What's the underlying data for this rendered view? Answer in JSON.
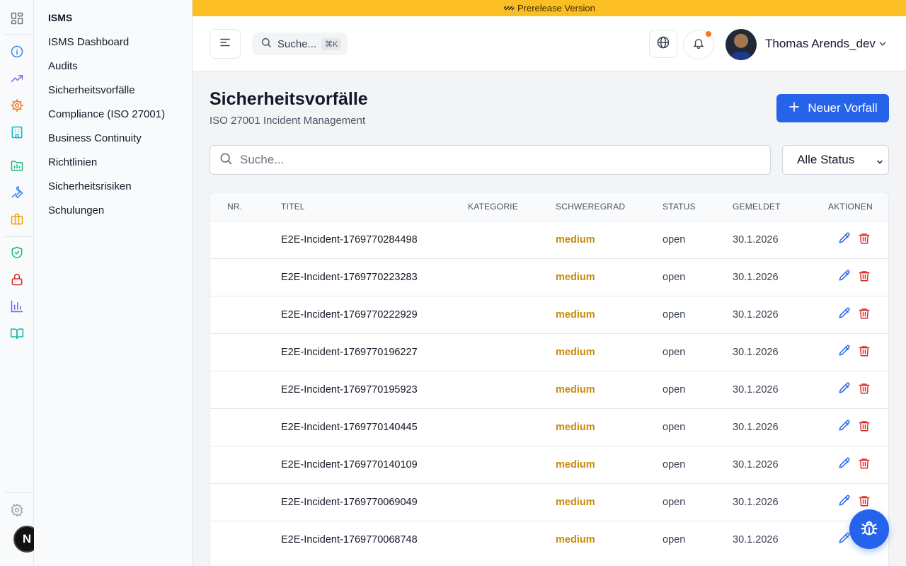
{
  "banner": {
    "text": "🚧 Prerelease Version"
  },
  "subnav": {
    "title": "ISMS",
    "items": [
      {
        "label": "ISMS Dashboard"
      },
      {
        "label": "Audits"
      },
      {
        "label": "Sicherheitsvorfälle"
      },
      {
        "label": "Compliance (ISO 27001)"
      },
      {
        "label": "Business Continuity"
      },
      {
        "label": "Richtlinien"
      },
      {
        "label": "Sicherheitsrisiken"
      },
      {
        "label": "Schulungen"
      }
    ]
  },
  "rail": {
    "icons": [
      "grid-icon",
      "info-icon",
      "trending-up-icon",
      "cog-icon",
      "building-icon",
      "folder-chart-icon",
      "wrench-icon",
      "briefcase-icon",
      "shield-check-icon",
      "lock-icon",
      "bar-chart-icon",
      "book-open-icon",
      "settings-icon"
    ],
    "badge": "N"
  },
  "header": {
    "search_placeholder": "Suche...",
    "search_shortcut": "⌘K",
    "user_name": "Thomas Arends_dev"
  },
  "page": {
    "title": "Sicherheitsvorfälle",
    "subtitle": "ISO 27001 Incident Management",
    "new_button_label": "Neuer Vorfall",
    "search_placeholder": "Suche...",
    "status_filter": "Alle Status"
  },
  "table": {
    "columns": [
      "NR.",
      "TITEL",
      "KATEGORIE",
      "SCHWEREGRAD",
      "STATUS",
      "GEMELDET",
      "AKTIONEN"
    ],
    "rows": [
      {
        "nr": "",
        "title": "E2E-Incident-1769770284498",
        "category": "",
        "severity": "medium",
        "status": "open",
        "reported": "30.1.2026"
      },
      {
        "nr": "",
        "title": "E2E-Incident-1769770223283",
        "category": "",
        "severity": "medium",
        "status": "open",
        "reported": "30.1.2026"
      },
      {
        "nr": "",
        "title": "E2E-Incident-1769770222929",
        "category": "",
        "severity": "medium",
        "status": "open",
        "reported": "30.1.2026"
      },
      {
        "nr": "",
        "title": "E2E-Incident-1769770196227",
        "category": "",
        "severity": "medium",
        "status": "open",
        "reported": "30.1.2026"
      },
      {
        "nr": "",
        "title": "E2E-Incident-1769770195923",
        "category": "",
        "severity": "medium",
        "status": "open",
        "reported": "30.1.2026"
      },
      {
        "nr": "",
        "title": "E2E-Incident-1769770140445",
        "category": "",
        "severity": "medium",
        "status": "open",
        "reported": "30.1.2026"
      },
      {
        "nr": "",
        "title": "E2E-Incident-1769770140109",
        "category": "",
        "severity": "medium",
        "status": "open",
        "reported": "30.1.2026"
      },
      {
        "nr": "",
        "title": "E2E-Incident-1769770069049",
        "category": "",
        "severity": "medium",
        "status": "open",
        "reported": "30.1.2026"
      },
      {
        "nr": "",
        "title": "E2E-Incident-1769770068748",
        "category": "",
        "severity": "medium",
        "status": "open",
        "reported": "30.1.2026"
      }
    ]
  },
  "colors": {
    "primary": "#2563eb",
    "banner": "#fbbf24",
    "severity_medium": "#ca8a04",
    "delete": "#dc2626"
  }
}
